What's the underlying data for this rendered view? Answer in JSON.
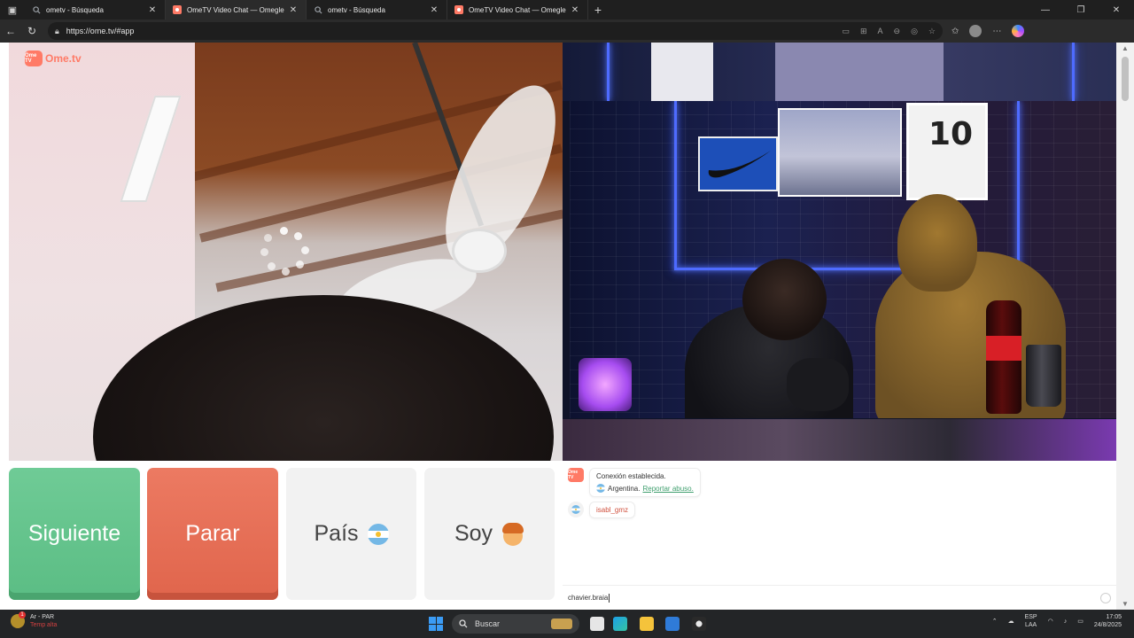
{
  "browser": {
    "tabs": [
      {
        "title": "ometv - Búsqueda",
        "icon": "search-icon",
        "active": false
      },
      {
        "title": "OmeTV Video Chat — Omegle",
        "icon": "ometv-record-icon",
        "active": true
      },
      {
        "title": "ometv - Búsqueda",
        "icon": "search-icon",
        "active": false
      },
      {
        "title": "OmeTV Video Chat — Omegle",
        "icon": "ometv-record-icon",
        "active": false
      }
    ],
    "url": "https://ome.tv/#app"
  },
  "app": {
    "brand": "Ome.tv",
    "brand_badge": "Ome TV",
    "buttons": {
      "next": "Siguiente",
      "stop": "Parar",
      "country": "País",
      "gender": "Soy"
    },
    "remote_overlay": {
      "jersey_number": "10"
    },
    "chat": {
      "system_message": "Conexión establecida.",
      "country": "Argentina.",
      "report_link": "Reportar abuso.",
      "partner_name": "isabl_gmz",
      "input_value": "chavier.braia"
    }
  },
  "taskbar": {
    "weather_line1": "Ar - PAR",
    "weather_line2": "Temp alta",
    "search_placeholder": "Buscar",
    "lang_line1": "ESP",
    "lang_line2": "LAA",
    "time": "17:05",
    "date": "24/8/2025"
  },
  "colors": {
    "next": "#5fbf88",
    "stop": "#e36a50",
    "brand": "#ff7a66",
    "link": "#3e9e6d"
  }
}
